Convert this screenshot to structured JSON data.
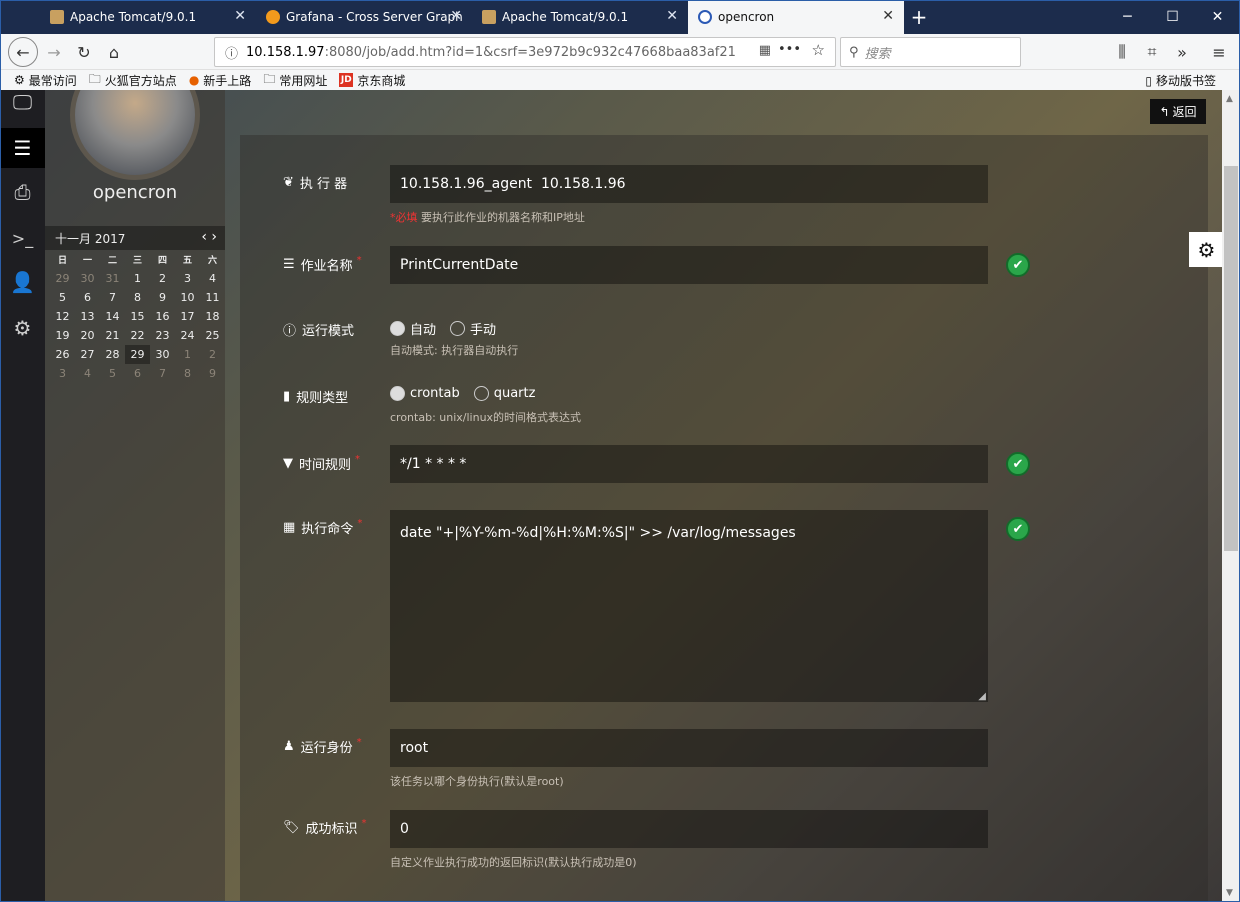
{
  "tabs": [
    {
      "title": "Apache Tomcat/9.0.1",
      "favicon_color": "#c8a060"
    },
    {
      "title": "Grafana - Cross Server Graph",
      "favicon_color": "#f29a1d"
    },
    {
      "title": "Apache Tomcat/9.0.1",
      "favicon_color": "#c8a060"
    },
    {
      "title": "opencron",
      "favicon_color": "#2b59b5"
    }
  ],
  "window_controls": {
    "minimize": "─",
    "maximize": "☐",
    "close": "✕"
  },
  "url": {
    "host": "10.158.1.97",
    "rest": ":8080/job/add.htm?id=1&csrf=3e972b9c932c47668baa83af21"
  },
  "search": {
    "placeholder": "搜索"
  },
  "bookmarks": [
    "最常访问",
    "火狐官方站点",
    "新手上路",
    "常用网址",
    "京东商城"
  ],
  "bookmarks_mobile": "移动版书签",
  "sidebar": {
    "username": "opencron"
  },
  "calendar": {
    "month_label": "十一月 2017",
    "weekdays": [
      "日",
      "一",
      "二",
      "三",
      "四",
      "五",
      "六"
    ],
    "weeks": [
      [
        "29",
        "30",
        "31",
        "1",
        "2",
        "3",
        "4"
      ],
      [
        "5",
        "6",
        "7",
        "8",
        "9",
        "10",
        "11"
      ],
      [
        "12",
        "13",
        "14",
        "15",
        "16",
        "17",
        "18"
      ],
      [
        "19",
        "20",
        "21",
        "22",
        "23",
        "24",
        "25"
      ],
      [
        "26",
        "27",
        "28",
        "29",
        "30",
        "1",
        "2"
      ],
      [
        "3",
        "4",
        "5",
        "6",
        "7",
        "8",
        "9"
      ]
    ],
    "today": "29"
  },
  "back_button": "返回",
  "form": {
    "executor": {
      "label": "执 行 器",
      "value": "10.158.1.96_agent  10.158.1.96",
      "help_red": "*必填",
      "help": "要执行此作业的机器名称和IP地址"
    },
    "job_name": {
      "label": "作业名称",
      "value": "PrintCurrentDate"
    },
    "run_mode": {
      "label": "运行模式",
      "options": [
        "自动",
        "手动"
      ],
      "selected": "自动",
      "help": "自动模式: 执行器自动执行"
    },
    "rule_type": {
      "label": "规则类型",
      "options": [
        "crontab",
        "quartz"
      ],
      "selected": "crontab",
      "help": "crontab: unix/linux的时间格式表达式"
    },
    "time_rule": {
      "label": "时间规则",
      "value": "*/1 * * * *"
    },
    "command": {
      "label": "执行命令",
      "value": "date \"+|%Y-%m-%d|%H:%M:%S|\" >> /var/log/messages"
    },
    "run_as": {
      "label": "运行身份",
      "value": "root",
      "help": "该任务以哪个身份执行(默认是root)"
    },
    "success_flag": {
      "label": "成功标识",
      "value": "0",
      "help": "自定义作业执行成功的返回标识(默认执行成功是0)"
    }
  }
}
